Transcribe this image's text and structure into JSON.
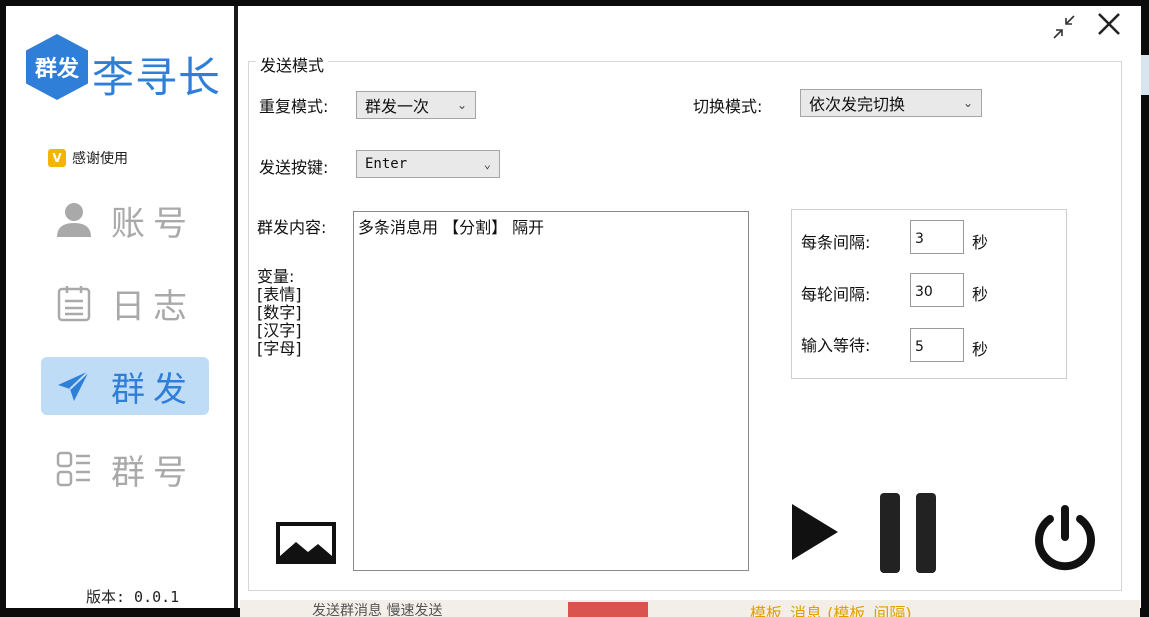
{
  "sidebar": {
    "logo_badge": "群发",
    "logo_text": "李寻长",
    "thanks_badge": "V",
    "thanks_label": "感谢使用",
    "items": [
      {
        "label": "账号",
        "icon": "user-icon",
        "active": false
      },
      {
        "label": "日志",
        "icon": "calendar-icon",
        "active": false
      },
      {
        "label": "群发",
        "icon": "send-icon",
        "active": true
      },
      {
        "label": "群号",
        "icon": "list-icon",
        "active": false
      }
    ],
    "version": "版本: 0.0.1"
  },
  "window": {
    "minimize_icon": "collapse-icon",
    "close_icon": "close-icon"
  },
  "form": {
    "group_title": "发送模式",
    "repeat_mode_label": "重复模式:",
    "repeat_mode_value": "群发一次",
    "switch_mode_label": "切换模式:",
    "switch_mode_value": "依次发完切换",
    "send_key_label": "发送按键:",
    "send_key_value": "Enter",
    "content_label": "群发内容:",
    "content_value": "多条消息用 【分割】 隔开",
    "vars_title": "变量:",
    "vars": [
      "[表情]",
      "[数字]",
      "[汉字]",
      "[字母]"
    ],
    "per_msg_label": "每条间隔:",
    "per_msg_value": "3",
    "per_round_label": "每轮间隔:",
    "per_round_value": "30",
    "input_wait_label": "输入等待:",
    "input_wait_value": "5",
    "unit": "秒"
  },
  "background_peek": {
    "text": "发送群消息 慢速发送",
    "yellow_text": "模板_消息 (模板_间隔)"
  },
  "colors": {
    "accent": "#2f7fd8",
    "active_bg": "#bfdcf6",
    "inactive_text": "#a9a9a9",
    "thanks_badge": "#f5b400"
  }
}
